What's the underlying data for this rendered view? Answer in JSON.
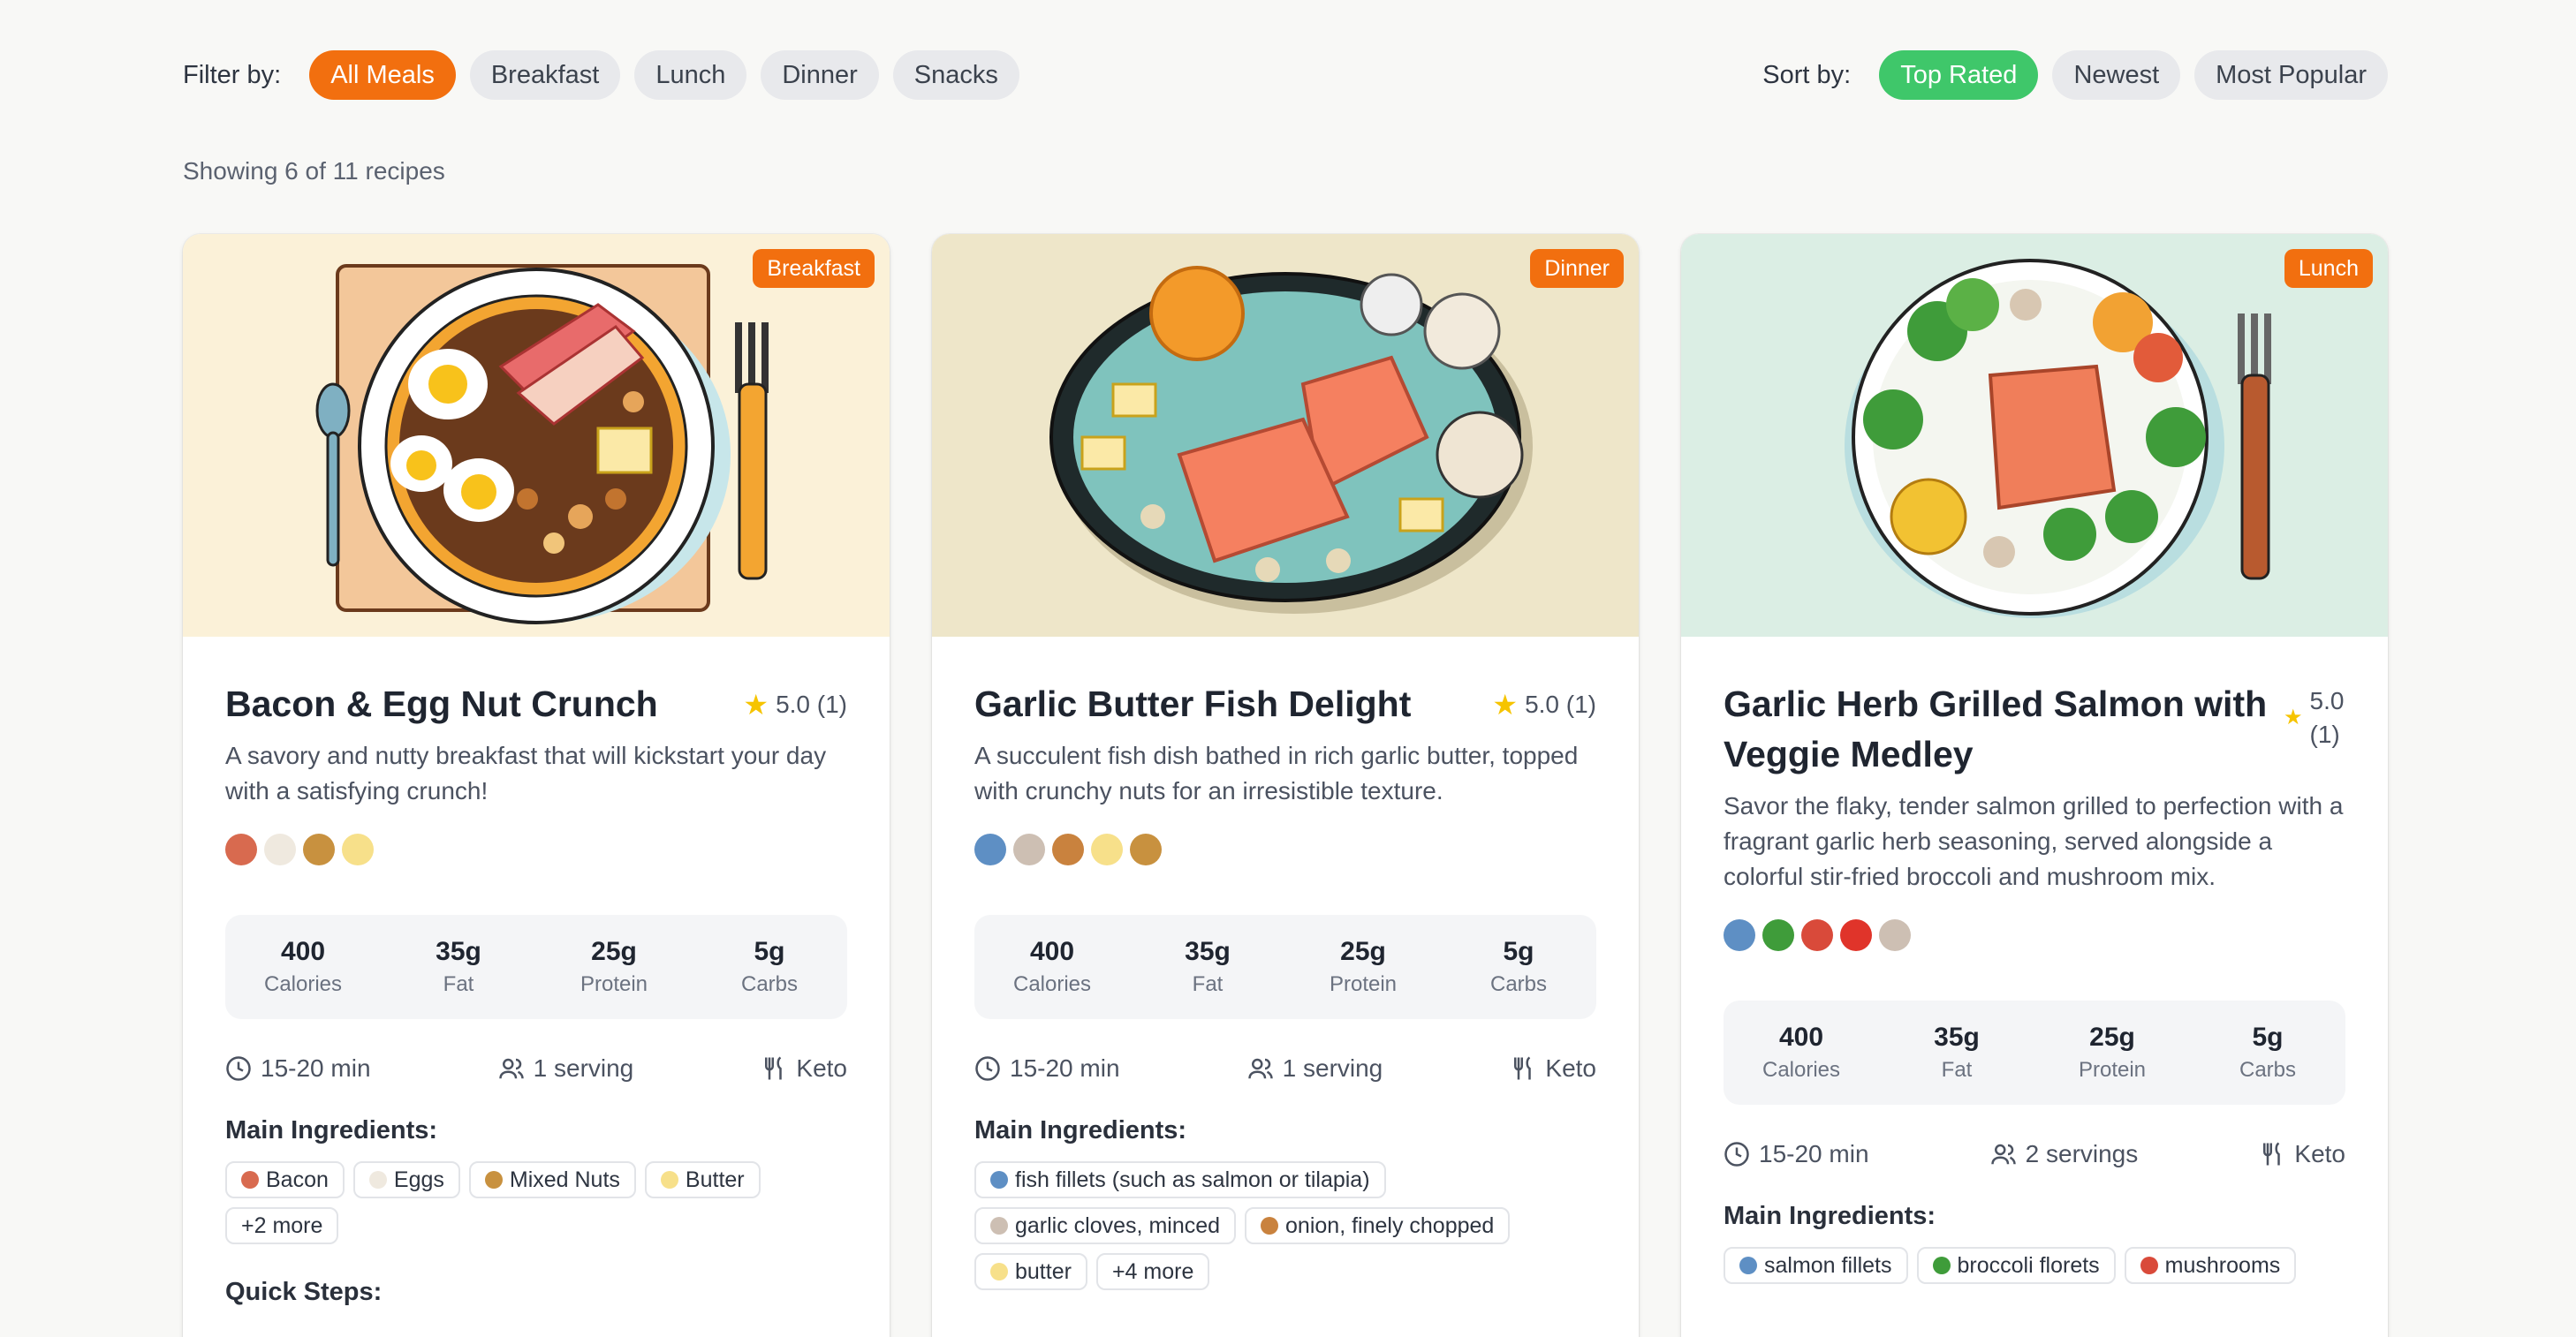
{
  "filter": {
    "label": "Filter by:",
    "options": [
      "All Meals",
      "Breakfast",
      "Lunch",
      "Dinner",
      "Snacks"
    ],
    "active": "All Meals"
  },
  "sort": {
    "label": "Sort by:",
    "options": [
      "Top Rated",
      "Newest",
      "Most Popular"
    ],
    "active": "Top Rated"
  },
  "results_text": "Showing 6 of 11 recipes",
  "labels": {
    "main_ingredients": "Main Ingredients:",
    "quick_steps": "Quick Steps:"
  },
  "colors": {
    "accent_orange": "#f26f0f",
    "accent_green": "#3fc76a",
    "star": "#f6c400"
  },
  "cards": [
    {
      "badge": "Breakfast",
      "title": "Bacon & Egg Nut Crunch",
      "rating": "5.0 (1)",
      "description": "A savory and nutty breakfast that will kickstart your day with a satisfying crunch!",
      "ingredient_icons": [
        "bacon-icon",
        "egg-icon",
        "nuts-icon",
        "butter-icon"
      ],
      "nutrition": [
        {
          "value": "400",
          "label": "Calories"
        },
        {
          "value": "35g",
          "label": "Fat"
        },
        {
          "value": "25g",
          "label": "Protein"
        },
        {
          "value": "5g",
          "label": "Carbs"
        }
      ],
      "time": "15-20 min",
      "servings": "1 serving",
      "diet": "Keto",
      "ingredients": [
        {
          "icon": "bacon-icon",
          "name": "Bacon"
        },
        {
          "icon": "egg-icon",
          "name": "Eggs"
        },
        {
          "icon": "nuts-icon",
          "name": "Mixed Nuts"
        },
        {
          "icon": "butter-icon",
          "name": "Butter"
        }
      ],
      "more": "+2 more",
      "show_steps": true
    },
    {
      "badge": "Dinner",
      "title": "Garlic Butter Fish Delight",
      "rating": "5.0 (1)",
      "description": "A succulent fish dish bathed in rich garlic butter, topped with crunchy nuts for an irresistible texture.",
      "ingredient_icons": [
        "fish-icon",
        "garlic-icon",
        "onion-icon",
        "butter-icon",
        "nuts-icon"
      ],
      "nutrition": [
        {
          "value": "400",
          "label": "Calories"
        },
        {
          "value": "35g",
          "label": "Fat"
        },
        {
          "value": "25g",
          "label": "Protein"
        },
        {
          "value": "5g",
          "label": "Carbs"
        }
      ],
      "time": "15-20 min",
      "servings": "1 serving",
      "diet": "Keto",
      "ingredients": [
        {
          "icon": "fish-icon",
          "name": "fish fillets (such as salmon or tilapia)"
        },
        {
          "icon": "garlic-icon",
          "name": "garlic cloves, minced"
        },
        {
          "icon": "onion-icon",
          "name": "onion, finely chopped"
        },
        {
          "icon": "butter-icon",
          "name": "butter"
        }
      ],
      "more": "+4 more",
      "show_steps": false
    },
    {
      "badge": "Lunch",
      "title": "Garlic Herb Grilled Salmon with Veggie Medley",
      "rating": "5.0 (1)",
      "description": "Savor the flaky, tender salmon grilled to perfection with a fragrant garlic herb seasoning, served alongside a colorful stir-fried broccoli and mushroom mix.",
      "ingredient_icons": [
        "fish-icon",
        "broccoli-icon",
        "mushroom-icon",
        "pepper-icon",
        "garlic-icon"
      ],
      "nutrition": [
        {
          "value": "400",
          "label": "Calories"
        },
        {
          "value": "35g",
          "label": "Fat"
        },
        {
          "value": "25g",
          "label": "Protein"
        },
        {
          "value": "5g",
          "label": "Carbs"
        }
      ],
      "time": "15-20 min",
      "servings": "2 servings",
      "diet": "Keto",
      "ingredients": [
        {
          "icon": "fish-icon",
          "name": "salmon fillets"
        },
        {
          "icon": "broccoli-icon",
          "name": "broccoli florets"
        },
        {
          "icon": "mushroom-icon",
          "name": "mushrooms"
        }
      ],
      "more": "",
      "show_steps": false
    }
  ]
}
